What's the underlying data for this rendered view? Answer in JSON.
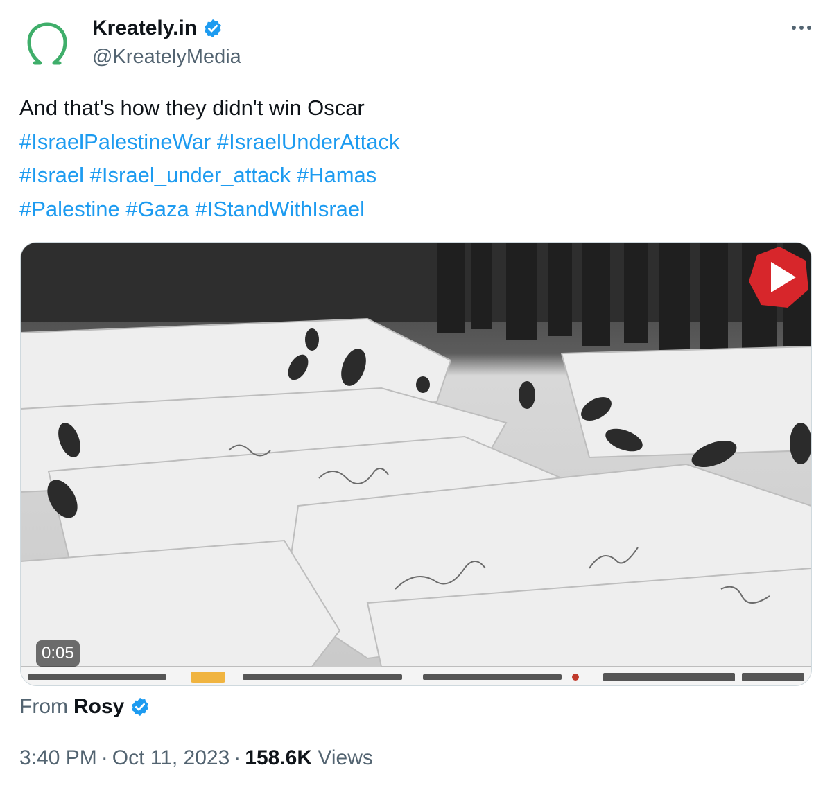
{
  "author": {
    "display_name": "Kreately.in",
    "handle": "@KreatelyMedia",
    "verified": true,
    "avatar_icon": "omega-logo-icon",
    "avatar_color": "#3fae6a"
  },
  "tweet": {
    "text": "And that's how they didn't win Oscar",
    "hashtags": {
      "h1": "#IsraelPalestineWar",
      "h2": "#IsraelUnderAttack",
      "h3": "#Israel",
      "h4": "#Israel_under_attack",
      "h5": "#Hamas",
      "h6": "#Palestine",
      "h7": "#Gaza",
      "h8": "#IStandWithIsrael"
    }
  },
  "media": {
    "type": "video",
    "duration": "0:05",
    "badge_icon": "play-badge-icon"
  },
  "source": {
    "label": "From",
    "name": "Rosy",
    "verified": true
  },
  "meta": {
    "time": "3:40 PM",
    "date": "Oct 11, 2023",
    "separator": "·",
    "views_count": "158.6K",
    "views_label": "Views"
  },
  "colors": {
    "link": "#1d9bf0",
    "secondary_text": "#536471",
    "primary_text": "#0f1419",
    "verified_badge": "#1d9bf0"
  }
}
